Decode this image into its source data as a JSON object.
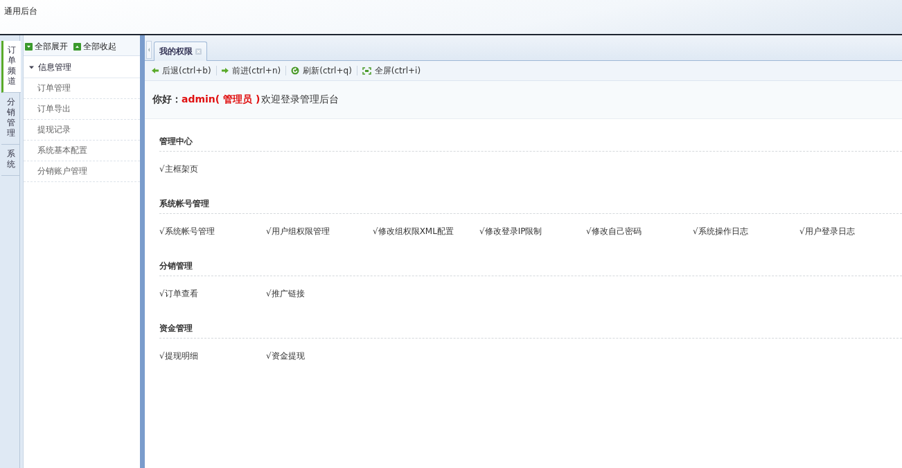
{
  "header": {
    "title": "通用后台"
  },
  "channel_tabs": [
    {
      "label": "订单频道",
      "selected": true
    },
    {
      "label": "分销管理",
      "selected": false
    },
    {
      "label": "系统",
      "selected": false
    }
  ],
  "sidebar": {
    "expand_all": "全部展开",
    "collapse_all": "全部收起",
    "groups": [
      {
        "label": "信息管理",
        "expanded": true,
        "children": [
          {
            "label": "订单管理"
          },
          {
            "label": "订单导出"
          },
          {
            "label": "提现记录"
          },
          {
            "label": "系统基本配置"
          },
          {
            "label": "分销账户管理"
          }
        ]
      }
    ]
  },
  "tabs": [
    {
      "label": "我的权限",
      "selected": true
    }
  ],
  "toolbar": [
    {
      "kind": "back",
      "label": "后退(ctrl+b)"
    },
    {
      "kind": "forward",
      "label": "前进(ctrl+n)"
    },
    {
      "kind": "refresh",
      "label": "刷新(ctrl+q)"
    },
    {
      "kind": "fullscreen",
      "label": "全屏(ctrl+i)"
    }
  ],
  "greeting": {
    "label": "你好：",
    "user": "admin( 管理员 )",
    "message": "欢迎登录管理后台"
  },
  "sections": [
    {
      "title": "管理中心",
      "items": [
        "√主框架页"
      ]
    },
    {
      "title": "系统帐号管理",
      "items": [
        "√系统帐号管理",
        "√用户组权限管理",
        "√修改组权限XML配置",
        "√修改登录IP限制",
        "√修改自己密码",
        "√系统操作日志",
        "√用户登录日志"
      ]
    },
    {
      "title": "分销管理",
      "items": [
        "√订单查看",
        "√推广链接"
      ]
    },
    {
      "title": "资金管理",
      "items": [
        "√提现明细",
        "√资金提现"
      ]
    }
  ]
}
